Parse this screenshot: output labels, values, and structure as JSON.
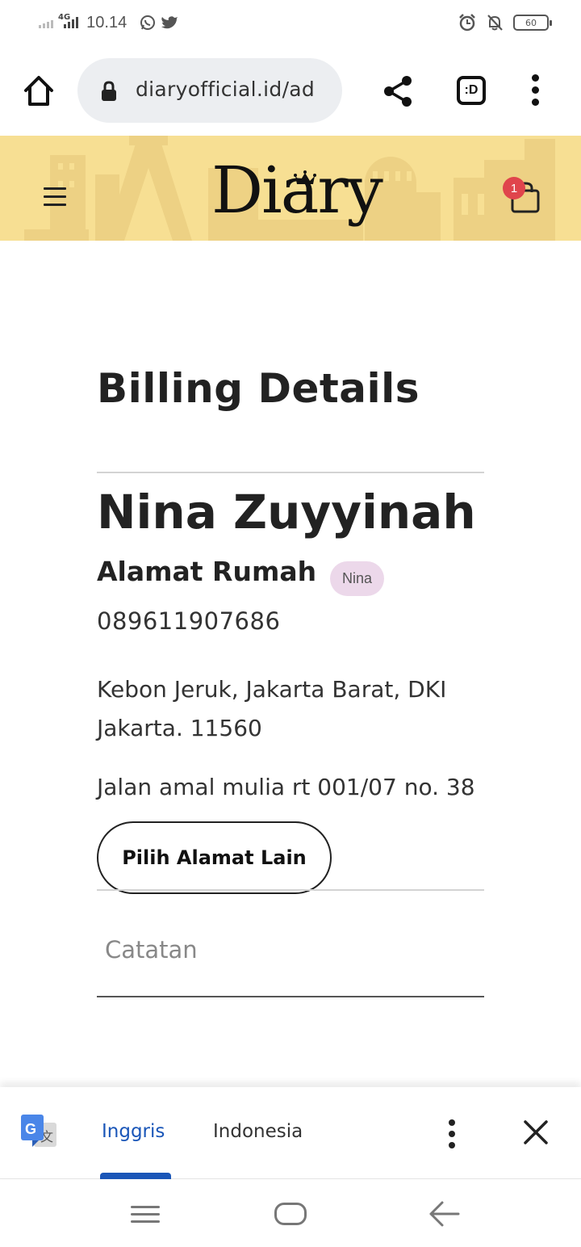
{
  "status_bar": {
    "network": "4G",
    "time": "10.14",
    "battery_level": "60",
    "icons": [
      "whatsapp-icon",
      "twitter-icon",
      "alarm-icon",
      "notifications-off-icon",
      "battery-icon"
    ]
  },
  "browser": {
    "url": "diaryofficial.id/ad",
    "tab_switcher_label": ":D",
    "icons": [
      "home-icon",
      "lock-icon",
      "share-icon",
      "more-vert-icon"
    ]
  },
  "site_header": {
    "logo_text": "Diary",
    "cart_count": "1",
    "colors": {
      "header_bg": "#f7df93",
      "badge": "#e0454c"
    },
    "icons": [
      "hamburger-menu-icon",
      "shopping-bag-icon",
      "crown-icon"
    ]
  },
  "billing": {
    "title": "Billing Details",
    "customer_name": "Nina Zuyyinah",
    "address_label": "Alamat Rumah",
    "address_tag": "Nina",
    "phone": "089611907686",
    "region": "Kebon Jeruk, Jakarta Barat, DKI Jakarta. 11560",
    "street": "Jalan amal mulia rt 001/07 no. 38",
    "change_address_button": "Pilih Alamat Lain",
    "notes_placeholder": "Catatan"
  },
  "translate_bar": {
    "source_lang": "Inggris",
    "target_lang": "Indonesia",
    "active_color": "#1a56b8",
    "icons": [
      "google-translate-icon",
      "more-vert-icon",
      "close-icon"
    ]
  },
  "nav_bar": {
    "icons": [
      "recent-apps-icon",
      "home-button-icon",
      "back-icon"
    ]
  }
}
